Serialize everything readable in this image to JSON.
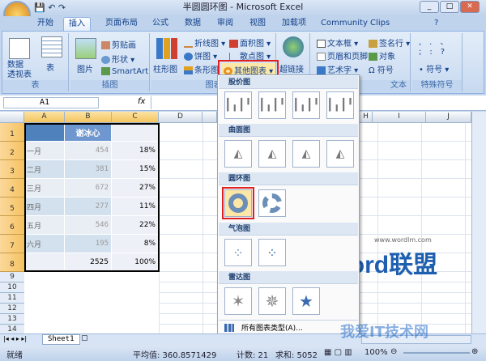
{
  "window": {
    "title": "半圆圆环图 - Microsoft Excel"
  },
  "tabs": [
    "开始",
    "插入",
    "页面布局",
    "公式",
    "数据",
    "审阅",
    "视图",
    "加载项",
    "Community Clips"
  ],
  "active_tab": "插入",
  "ribbon": {
    "table_group": {
      "label": "表",
      "pivot": "数据\n透视表",
      "table": "表"
    },
    "illus_group": {
      "label": "插图",
      "picture": "图片",
      "clipart": "剪贴画",
      "shapes": "形状",
      "smartart": "SmartArt"
    },
    "chart_group": {
      "label": "图表",
      "column": "柱形图",
      "line": "折线图",
      "pie": "饼图",
      "bar": "条形图",
      "area": "面积图",
      "scatter": "散点图",
      "other": "其他图表"
    },
    "link_group": {
      "hyperlink": "超链接"
    },
    "text_group": {
      "label": "文本",
      "textbox": "文本框",
      "header_footer": "页眉和页脚",
      "wordart": "艺术字",
      "signature": "签名行",
      "object": "对象",
      "symbol": "符号"
    },
    "special_group": {
      "label": "特殊符号",
      "symbol": "符号"
    }
  },
  "formula_bar": {
    "name_box": "A1",
    "fx": "fx",
    "value": ""
  },
  "columns": [
    "A",
    "B",
    "C",
    "D",
    "E",
    "F",
    "G",
    "H",
    "I",
    "J"
  ],
  "rows": [
    "1",
    "2",
    "3",
    "4",
    "5",
    "6",
    "7",
    "8",
    "9",
    "10",
    "11",
    "12",
    "13",
    "14"
  ],
  "sheet": {
    "header": "谢冰心",
    "data": [
      {
        "month": "一月",
        "value": "454",
        "pct": "18%"
      },
      {
        "month": "二月",
        "value": "381",
        "pct": "15%"
      },
      {
        "month": "三月",
        "value": "672",
        "pct": "27%"
      },
      {
        "month": "四月",
        "value": "277",
        "pct": "11%"
      },
      {
        "month": "五月",
        "value": "546",
        "pct": "22%"
      },
      {
        "month": "六月",
        "value": "195",
        "pct": "8%"
      }
    ],
    "total": "2525",
    "total_pct": "100%"
  },
  "menu": {
    "sections": [
      "股价图",
      "曲面图",
      "圆环图",
      "气泡图",
      "雷达图"
    ],
    "all_types": "所有图表类型(A)..."
  },
  "watermark": {
    "word": "Word联盟",
    "url": "www.wordlm.com",
    "site": "我爱IT技术网"
  },
  "sheet_tabs": [
    "Sheet1"
  ],
  "status": {
    "ready": "就绪",
    "average": "平均值: 360.8571429",
    "count": "计数: 21",
    "sum": "求和: 5052",
    "zoom": "100%"
  }
}
